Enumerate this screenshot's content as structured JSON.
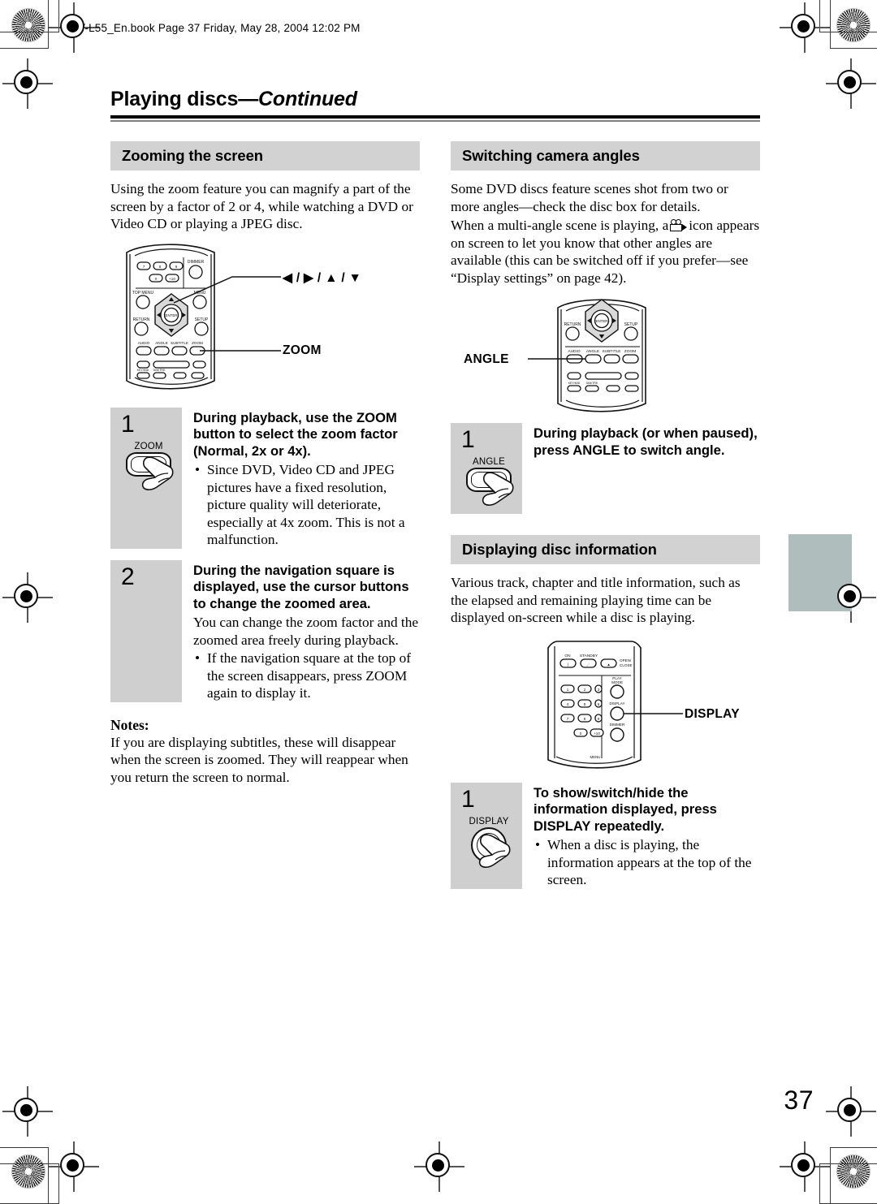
{
  "header": {
    "slug": "DV-L55_En.book  Page 37  Friday, May 28, 2004  12:02 PM"
  },
  "page": {
    "title_main": "Playing discs",
    "title_dash": "—",
    "title_cont": "Continued",
    "folio": "37"
  },
  "colors": {
    "section_head_bg": "#d2d2d2",
    "step_box_bg": "#cfcfcf",
    "thumb_tab": "#b0bdbd",
    "rule": "#000000"
  },
  "left_column": {
    "section": {
      "heading": "Zooming the screen",
      "intro": "Using the zoom feature you can magnify a part of the screen by a factor of 2 or 4, while watching a DVD or Video CD or playing a JPEG disc."
    },
    "remote": {
      "name": "remote-upper-diagram",
      "callouts": [
        {
          "label": "◀ / ▶ / ▲ / ▼",
          "target": "cursor-buttons"
        },
        {
          "label": "ZOOM",
          "target": "zoom-button"
        }
      ],
      "keys": {
        "numbers": [
          "7",
          "8",
          "9",
          "0",
          "+10"
        ],
        "dimmer": "DIMMER",
        "top_menu": "TOP MENU",
        "menu": "MENU",
        "enter": "ENTER",
        "return": "RETURN",
        "setup": "SETUP",
        "function_row": [
          "AUDIO",
          "ANGLE",
          "SUBTITLE",
          "ZOOM"
        ]
      }
    },
    "steps": [
      {
        "number": "1",
        "key_label": "ZOOM",
        "key_shape": "rect",
        "title": "During playback, use the ZOOM button to select the zoom factor (Normal, 2x or 4x).",
        "bullets": [
          "Since DVD, Video CD and JPEG pictures have a fixed resolution, picture quality will deteriorate, especially at 4x zoom. This is not a malfunction."
        ],
        "note": ""
      },
      {
        "number": "2",
        "key_label": "",
        "key_shape": "none",
        "title": "During the navigation square is displayed, use the cursor buttons to change the zoomed area.",
        "note": "You can change the zoom factor and the zoomed area freely during playback.",
        "bullets": [
          "If the navigation square at the top of the screen disappears, press ZOOM again to display it."
        ]
      }
    ],
    "notes": {
      "heading": "Notes:",
      "text": "If you are displaying subtitles, these will disappear when the screen is zoomed. They will reappear when you return the screen to normal."
    }
  },
  "right_column": {
    "section_angles": {
      "heading": "Switching camera angles",
      "para1": "Some DVD discs feature scenes shot from two or more angles—check the disc box for details.",
      "para2_before": "When a multi-angle scene is playing, a",
      "para2_after": "icon appears on screen to let you know that other angles are available (this can be switched off if you prefer—see “Display settings” on page 42).",
      "inline_icon": "camera-angle-icon"
    },
    "remote_angle": {
      "name": "remote-middle-diagram",
      "callouts": [
        {
          "label": "ANGLE",
          "target": "angle-button"
        }
      ],
      "keys": {
        "enter": "ENTER",
        "return": "RETURN",
        "setup": "SETUP",
        "function_row": [
          "AUDIO",
          "ANGLE",
          "SUBTITLE",
          "ZOOM"
        ]
      }
    },
    "step_angle": {
      "number": "1",
      "key_label": "ANGLE",
      "key_shape": "rect",
      "title": "During playback (or when paused), press ANGLE to switch angle."
    },
    "section_display": {
      "heading": "Displaying disc information",
      "para1": "Various track, chapter and title information, such as the elapsed and remaining playing time can be displayed on-screen while a disc is playing."
    },
    "remote_display": {
      "name": "remote-top-diagram",
      "callouts": [
        {
          "label": "DISPLAY",
          "target": "display-button"
        }
      ],
      "keys": {
        "on": "ON",
        "standby": "STANDBY",
        "open_close": "OPEN/ CLOSE",
        "numbers": [
          "1",
          "2",
          "3",
          "4",
          "5",
          "6",
          "7",
          "8",
          "9",
          "0",
          "+10"
        ],
        "play_mode": "PLAY MODE",
        "display": "DISPLAY",
        "dimmer": "DIMMER"
      }
    },
    "step_display": {
      "number": "1",
      "key_label": "DISPLAY",
      "key_shape": "circle",
      "title": "To show/switch/hide the information displayed, press DISPLAY repeatedly.",
      "bullets": [
        "When a disc is playing, the information appears at the top of the screen."
      ]
    }
  }
}
